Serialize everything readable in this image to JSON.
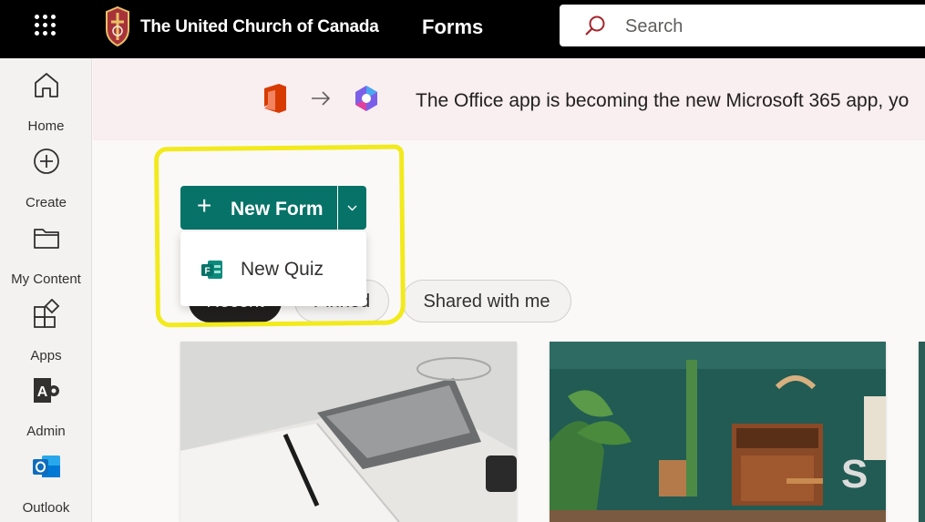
{
  "header": {
    "org_name": "The United Church of Canada",
    "app_name": "Forms",
    "search_placeholder": "Search",
    "waffle_icon": "app-launcher-icon",
    "brand_bg": "#000000"
  },
  "rail": {
    "items": [
      {
        "label": "Home",
        "icon": "home-icon"
      },
      {
        "label": "Create",
        "icon": "plus-circle-icon"
      },
      {
        "label": "My Content",
        "icon": "folder-icon"
      },
      {
        "label": "Apps",
        "icon": "apps-icon"
      },
      {
        "label": "Admin",
        "icon": "admin-icon"
      },
      {
        "label": "Outlook",
        "icon": "outlook-icon"
      }
    ]
  },
  "banner": {
    "text": "The Office app is becoming the new Microsoft 365 app, yo"
  },
  "new_form": {
    "label": "New Form",
    "accent": "#077368"
  },
  "dropdown": {
    "items": [
      {
        "label": "New Quiz",
        "icon": "forms-quiz-icon"
      }
    ]
  },
  "tabs": [
    {
      "label": "Recent",
      "selected": true
    },
    {
      "label": "Pinned",
      "selected": false
    },
    {
      "label": "Shared with me",
      "selected": false
    }
  ],
  "highlight_color": "#f2ea1c"
}
